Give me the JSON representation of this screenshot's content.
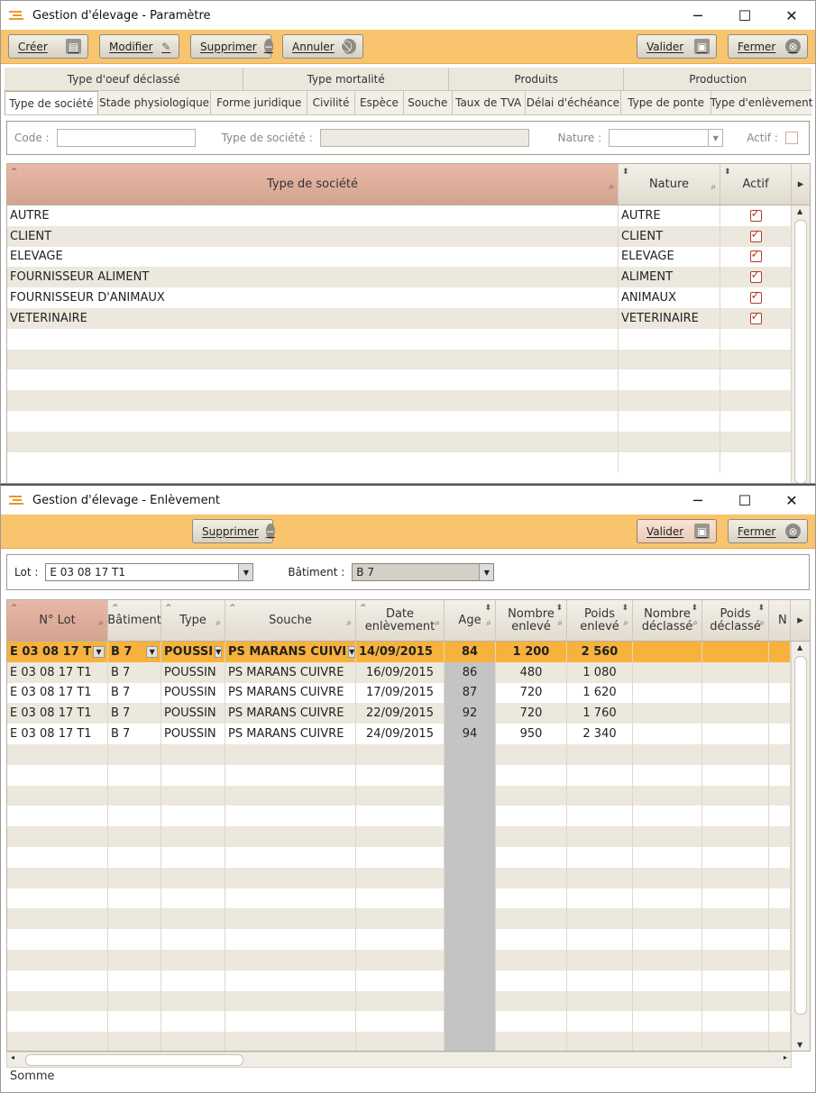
{
  "win1": {
    "title": "Gestion d'élevage - Paramètre",
    "toolbar": {
      "creer": "Créer",
      "modifier": "Modifier",
      "supprimer": "Supprimer",
      "annuler": "Annuler",
      "valider": "Valider",
      "fermer": "Fermer"
    },
    "tabs_top": [
      "Type d'oeuf déclassé",
      "Type mortalité",
      "Produits",
      "Production"
    ],
    "tabs": [
      "Type de société",
      "Stade physiologique",
      "Forme juridique",
      "Civilité",
      "Espèce",
      "Souche",
      "Taux de TVA",
      "Délai d'échéance",
      "Type de ponte",
      "Type d'enlèvement"
    ],
    "filter": {
      "code_label": "Code :",
      "type_label": "Type de société :",
      "nature_label": "Nature :",
      "actif_label": "Actif :"
    },
    "grid": {
      "headers": [
        "Type de société",
        "Nature",
        "Actif"
      ],
      "rows": [
        [
          "AUTRE",
          "AUTRE"
        ],
        [
          "CLIENT",
          "CLIENT"
        ],
        [
          "ELEVAGE",
          "ELEVAGE"
        ],
        [
          "FOURNISSEUR ALIMENT",
          "ALIMENT"
        ],
        [
          "FOURNISSEUR D'ANIMAUX",
          "ANIMAUX"
        ],
        [
          "VETERINAIRE",
          "VETERINAIRE"
        ]
      ]
    }
  },
  "win2": {
    "title": "Gestion d'élevage - Enlèvement",
    "toolbar": {
      "supprimer": "Supprimer",
      "valider": "Valider",
      "fermer": "Fermer"
    },
    "filter": {
      "lot_label": "Lot :",
      "lot_value": "E 03 08 17 T1",
      "batiment_label": "Bâtiment :",
      "batiment_value": "B 7"
    },
    "grid": {
      "headers": [
        "N° Lot",
        "Bâtiment",
        "Type",
        "Souche",
        "Date enlèvement",
        "Age",
        "Nombre enlevé",
        "Poids enlevé",
        "Nombre déclassé",
        "Poids déclassé",
        "N"
      ],
      "selected": [
        "E 03 08 17 T",
        "B 7",
        "POUSSI",
        "PS MARANS CUIVI",
        "14/09/2015",
        "84",
        "1 200",
        "2 560"
      ],
      "rows": [
        [
          "E 03 08 17 T1",
          "B 7",
          "POUSSIN",
          "PS MARANS CUIVRE",
          "16/09/2015",
          "86",
          "480",
          "1 080"
        ],
        [
          "E 03 08 17 T1",
          "B 7",
          "POUSSIN",
          "PS MARANS CUIVRE",
          "17/09/2015",
          "87",
          "720",
          "1 620"
        ],
        [
          "E 03 08 17 T1",
          "B 7",
          "POUSSIN",
          "PS MARANS CUIVRE",
          "22/09/2015",
          "92",
          "720",
          "1 760"
        ],
        [
          "E 03 08 17 T1",
          "B 7",
          "POUSSIN",
          "PS MARANS CUIVRE",
          "24/09/2015",
          "94",
          "950",
          "2 340"
        ]
      ]
    },
    "footer": "Somme"
  },
  "colors": {
    "toolbar": "#f9c46e",
    "selected_row": "#f7b23d",
    "sorted_header": "#d9ab98"
  }
}
